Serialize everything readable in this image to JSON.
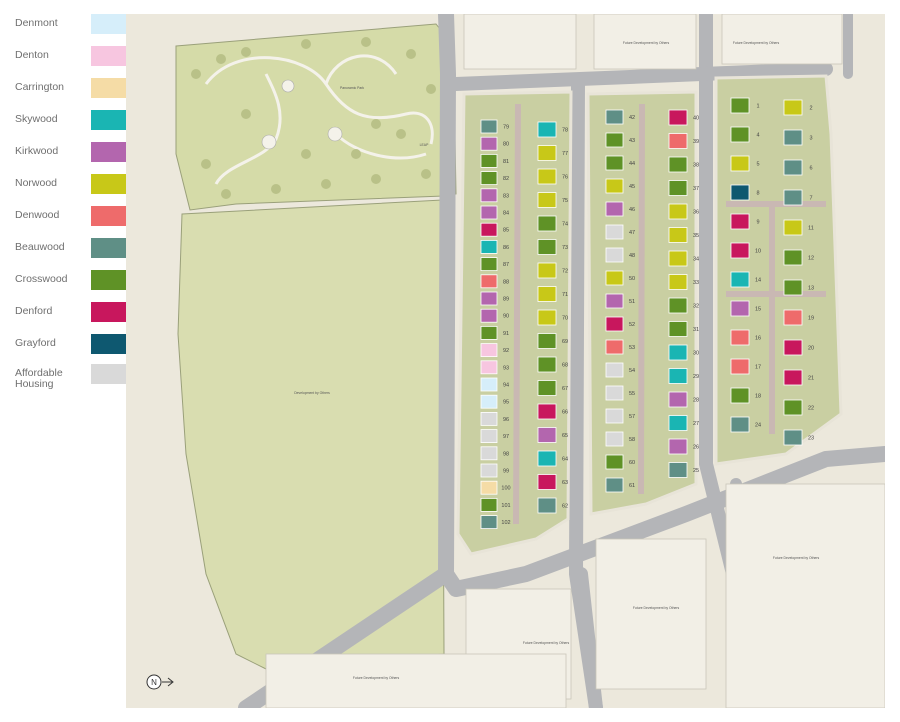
{
  "legend": {
    "items": [
      {
        "label": "Denmont",
        "color": "#d6eefa"
      },
      {
        "label": "Denton",
        "color": "#f7c6e0"
      },
      {
        "label": "Carrington",
        "color": "#f5dca6"
      },
      {
        "label": "Skywood",
        "color": "#1ab5b3"
      },
      {
        "label": "Kirkwood",
        "color": "#b366ae"
      },
      {
        "label": "Norwood",
        "color": "#c8c818"
      },
      {
        "label": "Denwood",
        "color": "#ee6b6b"
      },
      {
        "label": "Beauwood",
        "color": "#5f8f86"
      },
      {
        "label": "Crosswood",
        "color": "#5f9226"
      },
      {
        "label": "Denford",
        "color": "#c8175d"
      },
      {
        "label": "Grayford",
        "color": "#0e5870"
      },
      {
        "label": "Affordable Housing",
        "color": "#d9d9d9"
      }
    ]
  },
  "map": {
    "park_label": "Panoramic Park",
    "leap_label": "LEAP",
    "development_label": "Development by Others",
    "future_label": "Future Development by Others",
    "compass": "N",
    "colors": {
      "green_space": "#d9ddb0",
      "park_bg": "#d3d9a5",
      "road": "#b4b5b8",
      "pavement": "#e8e4d8",
      "plot_ground": "#c9cfa2",
      "parking": "#c9b8b3"
    },
    "plots": {
      "col_a": [
        [
          "79",
          "#5f8f86"
        ],
        [
          "80",
          "#b366ae"
        ],
        [
          "81",
          "#5f9226"
        ],
        [
          "82",
          "#5f9226"
        ],
        [
          "83",
          "#b366ae"
        ],
        [
          "84",
          "#b366ae"
        ],
        [
          "85",
          "#c8175d"
        ],
        [
          "86",
          "#1ab5b3"
        ],
        [
          "87",
          "#5f9226"
        ],
        [
          "88",
          "#ee6b6b"
        ],
        [
          "89",
          "#b366ae"
        ],
        [
          "90",
          "#b366ae"
        ],
        [
          "91",
          "#5f9226"
        ],
        [
          "92",
          "#f7c6e0"
        ],
        [
          "93",
          "#f7c6e0"
        ],
        [
          "94",
          "#d6eefa"
        ],
        [
          "95",
          "#d6eefa"
        ],
        [
          "96",
          "#d9d9d9"
        ],
        [
          "97",
          "#d9d9d9"
        ],
        [
          "98",
          "#d9d9d9"
        ],
        [
          "99",
          "#d9d9d9"
        ],
        [
          "100",
          "#f5dca6"
        ],
        [
          "101",
          "#5f9226"
        ],
        [
          "102",
          "#5f8f86"
        ]
      ],
      "col_b": [
        [
          "78",
          "#1ab5b3"
        ],
        [
          "77",
          "#c8c818"
        ],
        [
          "76",
          "#c8c818"
        ],
        [
          "75",
          "#c8c818"
        ],
        [
          "74",
          "#5f9226"
        ],
        [
          "73",
          "#5f9226"
        ],
        [
          "72",
          "#c8c818"
        ],
        [
          "71",
          "#c8c818"
        ],
        [
          "70",
          "#c8c818"
        ],
        [
          "69",
          "#5f9226"
        ],
        [
          "68",
          "#5f9226"
        ],
        [
          "67",
          "#5f9226"
        ],
        [
          "66",
          "#c8175d"
        ],
        [
          "65",
          "#b366ae"
        ],
        [
          "64",
          "#1ab5b3"
        ],
        [
          "63",
          "#c8175d"
        ],
        [
          "62",
          "#5f8f86"
        ]
      ],
      "col_c": [
        [
          "42",
          "#5f8f86"
        ],
        [
          "43",
          "#5f9226"
        ],
        [
          "44",
          "#5f9226"
        ],
        [
          "45",
          "#c8c818"
        ],
        [
          "46",
          "#b366ae"
        ],
        [
          "47",
          "#d9d9d9"
        ],
        [
          "48",
          "#d9d9d9"
        ],
        [
          "50",
          "#c8c818"
        ],
        [
          "51",
          "#b366ae"
        ],
        [
          "52",
          "#c8175d"
        ],
        [
          "53",
          "#ee6b6b"
        ],
        [
          "54",
          "#d9d9d9"
        ],
        [
          "55",
          "#d9d9d9"
        ],
        [
          "57",
          "#d9d9d9"
        ],
        [
          "58",
          "#d9d9d9"
        ],
        [
          "60",
          "#5f9226"
        ],
        [
          "61",
          "#5f8f86"
        ]
      ],
      "col_d": [
        [
          "40",
          "#c8175d"
        ],
        [
          "39",
          "#ee6b6b"
        ],
        [
          "38",
          "#5f9226"
        ],
        [
          "37",
          "#5f9226"
        ],
        [
          "36",
          "#c8c818"
        ],
        [
          "35",
          "#c8c818"
        ],
        [
          "34",
          "#c8c818"
        ],
        [
          "33",
          "#c8c818"
        ],
        [
          "32",
          "#5f9226"
        ],
        [
          "31",
          "#5f9226"
        ],
        [
          "30",
          "#1ab5b3"
        ],
        [
          "29",
          "#1ab5b3"
        ],
        [
          "28",
          "#b366ae"
        ],
        [
          "27",
          "#1ab5b3"
        ],
        [
          "26",
          "#b366ae"
        ],
        [
          "25",
          "#5f8f86"
        ]
      ],
      "col_e": [
        [
          "1",
          "#5f9226"
        ],
        [
          "4",
          "#5f9226"
        ],
        [
          "5",
          "#c8c818"
        ],
        [
          "8",
          "#0e5870"
        ],
        [
          "9",
          "#c8175d"
        ],
        [
          "10",
          "#c8175d"
        ],
        [
          "14",
          "#1ab5b3"
        ],
        [
          "15",
          "#b366ae"
        ],
        [
          "16",
          "#ee6b6b"
        ],
        [
          "17",
          "#ee6b6b"
        ],
        [
          "18",
          "#5f9226"
        ],
        [
          "24",
          "#5f8f86"
        ]
      ],
      "col_f": [
        [
          "2",
          "#c8c818"
        ],
        [
          "3",
          "#5f8f86"
        ],
        [
          "6",
          "#5f8f86"
        ],
        [
          "7",
          "#5f8f86"
        ],
        [
          "11",
          "#c8c818"
        ],
        [
          "12",
          "#5f9226"
        ],
        [
          "13",
          "#5f9226"
        ],
        [
          "19",
          "#ee6b6b"
        ],
        [
          "20",
          "#c8175d"
        ],
        [
          "21",
          "#c8175d"
        ],
        [
          "22",
          "#5f9226"
        ],
        [
          "23",
          "#5f8f86"
        ]
      ]
    }
  }
}
